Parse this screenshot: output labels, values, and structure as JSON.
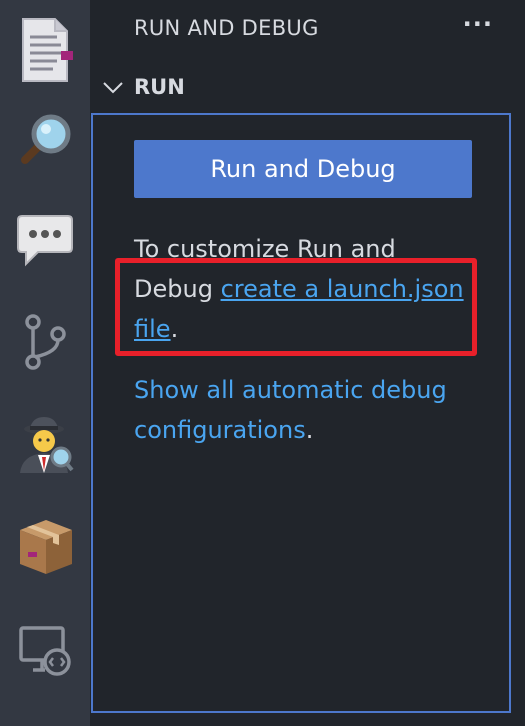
{
  "activity_bar": {
    "items": [
      {
        "icon": "document-icon"
      },
      {
        "icon": "magnifier-icon"
      },
      {
        "icon": "speech-balloon-icon"
      },
      {
        "icon": "source-control-icon"
      },
      {
        "icon": "detective-icon"
      },
      {
        "icon": "package-icon"
      },
      {
        "icon": "remote-explorer-icon"
      }
    ]
  },
  "sidebar": {
    "title": "RUN AND DEBUG",
    "more_label": "···",
    "section": {
      "title": "RUN",
      "button_label": "Run and Debug",
      "text_before": "To customize Run and Debug ",
      "link_launch": "create a launch.json file",
      "text_after": ".",
      "link_show": "Show all automatic debug configurations",
      "text_after2": "."
    }
  },
  "colors": {
    "accent": "#4d78cc",
    "link": "#4aa5f0",
    "highlight": "#e8202a",
    "activity_bar": "#333842",
    "sidebar": "#21252b"
  }
}
